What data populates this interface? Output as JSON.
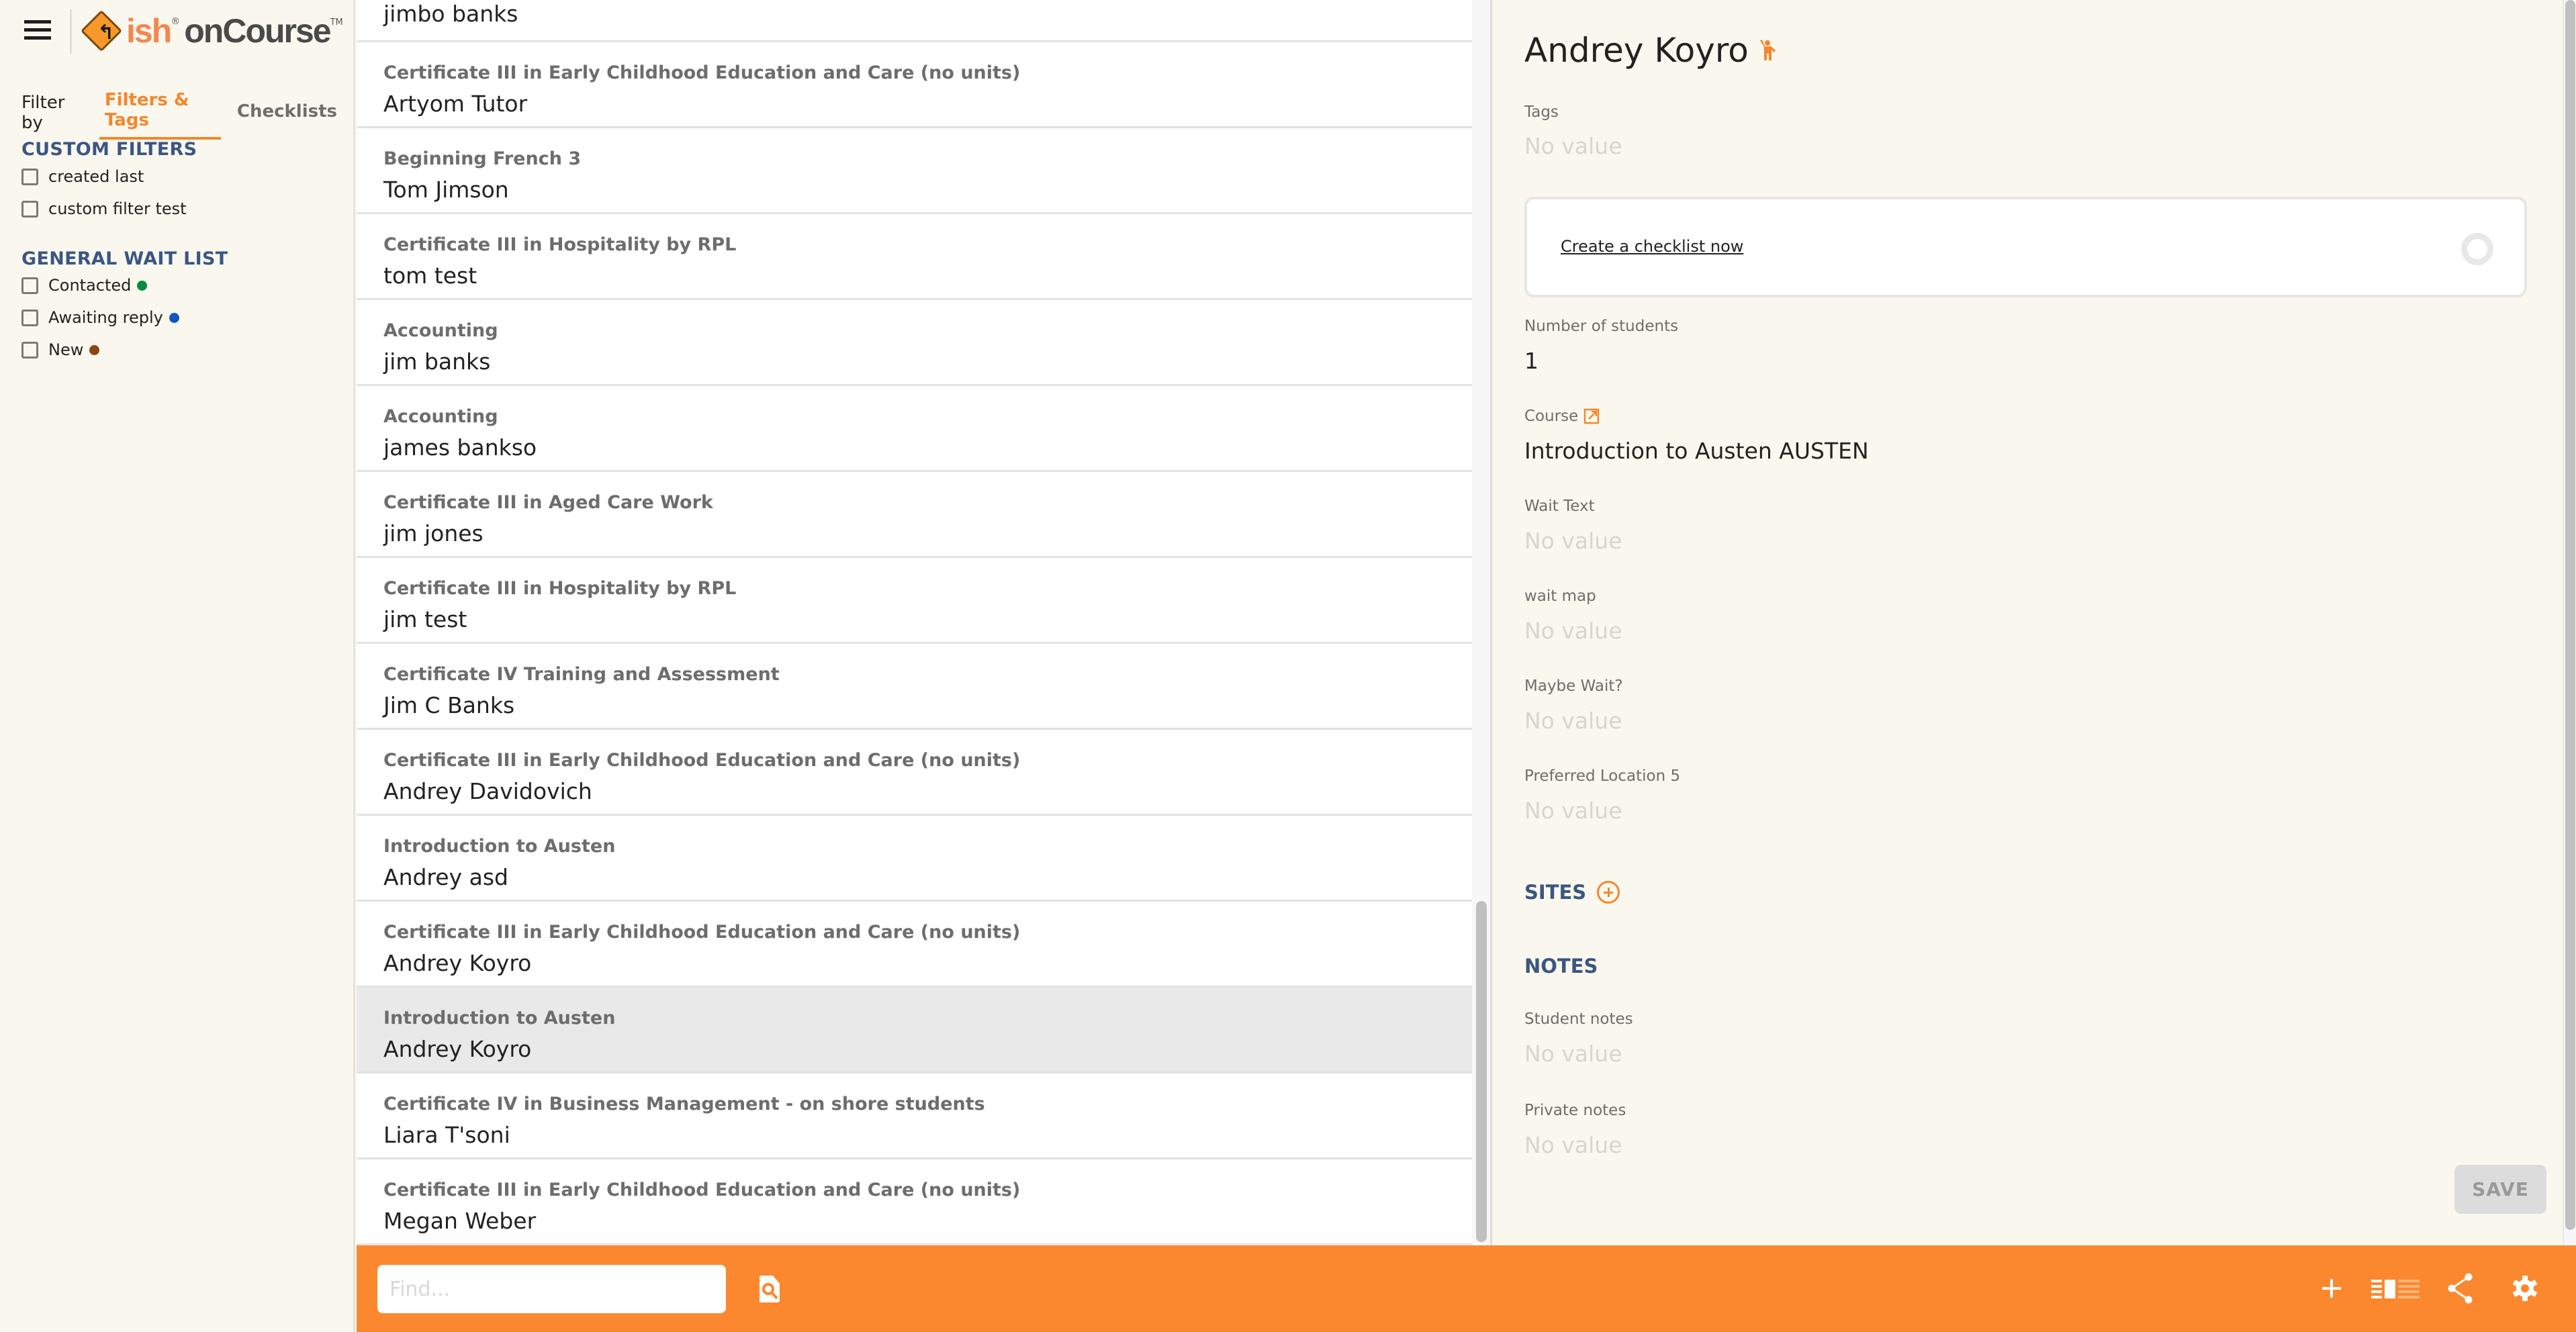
{
  "app": {
    "brand_ish": "ish",
    "brand_reg": "®",
    "brand_oncourse": "onCourse",
    "brand_tm": "TM"
  },
  "colors": {
    "accent": "#fb882e",
    "heading": "#3b5683",
    "contacted": "#0b8a3e",
    "awaiting": "#1155c8",
    "new": "#8b4513"
  },
  "sidebar": {
    "filter_by_label": "Filter by",
    "tabs": [
      {
        "label": "Filters & Tags",
        "active": true
      },
      {
        "label": "Checklists",
        "active": false
      }
    ],
    "custom_filters": {
      "title": "CUSTOM FILTERS",
      "items": [
        {
          "label": "created last",
          "checked": false
        },
        {
          "label": "custom filter test",
          "checked": false
        }
      ]
    },
    "general_wait_list": {
      "title": "GENERAL WAIT LIST",
      "items": [
        {
          "label": "Contacted",
          "checked": false,
          "dot": "green"
        },
        {
          "label": "Awaiting reply",
          "checked": false,
          "dot": "blue"
        },
        {
          "label": "New",
          "checked": false,
          "dot": "brown"
        }
      ]
    }
  },
  "list": {
    "partial_top": {
      "person": "jimbo banks"
    },
    "rows": [
      {
        "course": "Certificate III in Early Childhood Education and Care (no units)",
        "person": "Artyom Tutor"
      },
      {
        "course": "Beginning French 3",
        "person": "Tom Jimson"
      },
      {
        "course": "Certificate III in Hospitality by RPL",
        "person": "tom test"
      },
      {
        "course": "Accounting",
        "person": "jim banks"
      },
      {
        "course": "Accounting",
        "person": "james bankso"
      },
      {
        "course": "Certificate III in Aged Care Work",
        "person": "jim jones"
      },
      {
        "course": "Certificate III in Hospitality by RPL",
        "person": "jim test"
      },
      {
        "course": "Certificate IV Training and Assessment",
        "person": "Jim C Banks"
      },
      {
        "course": "Certificate III in Early Childhood Education and Care (no units)",
        "person": "Andrey Davidovich"
      },
      {
        "course": "Introduction to Austen",
        "person": "Andrey asd"
      },
      {
        "course": "Certificate III in Early Childhood Education and Care (no units)",
        "person": "Andrey Koyro"
      },
      {
        "course": "Introduction to Austen",
        "person": "Andrey Koyro",
        "selected": true
      },
      {
        "course": "Certificate IV in Business Management - on shore students",
        "person": "Liara T'soni"
      },
      {
        "course": "Certificate III in Early Childhood Education and Care (no units)",
        "person": "Megan Weber"
      }
    ]
  },
  "detail": {
    "title": "Andrey Koyro",
    "tags": {
      "label": "Tags",
      "value": "No value"
    },
    "checklist_link": "Create a checklist now",
    "number_of_students": {
      "label": "Number of students",
      "value": "1"
    },
    "course": {
      "label": "Course",
      "value": "Introduction to Austen AUSTEN"
    },
    "wait_text": {
      "label": "Wait Text",
      "value": "No value"
    },
    "wait_map": {
      "label": "wait map",
      "value": "No value"
    },
    "maybe_wait": {
      "label": "Maybe Wait?",
      "value": "No value"
    },
    "preferred_location": {
      "label": "Preferred Location 5",
      "value": "No value"
    },
    "sites_title": "SITES",
    "notes_title": "NOTES",
    "student_notes": {
      "label": "Student notes",
      "value": "No value"
    },
    "private_notes": {
      "label": "Private notes",
      "value": "No value"
    },
    "save_label": "SAVE"
  },
  "bottombar": {
    "find_placeholder": "Find...",
    "find_value": ""
  }
}
